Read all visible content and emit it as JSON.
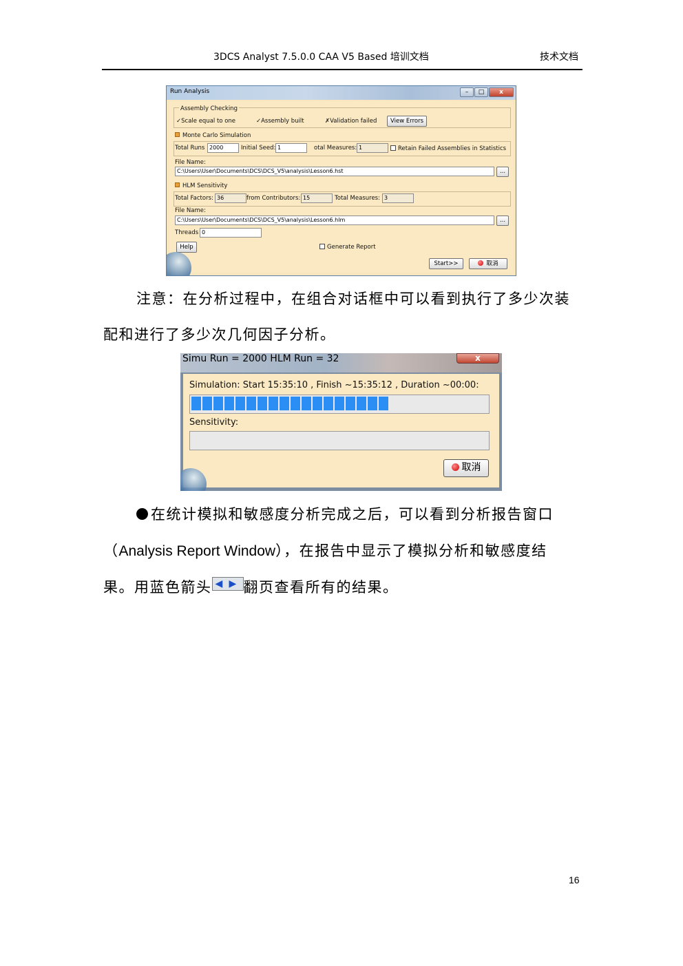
{
  "header": {
    "title": "3DCS Analyst 7.5.0.0 CAA V5 Based 培训文档",
    "doc_type": "技术文档"
  },
  "run_analysis": {
    "title": "Run Analysis",
    "assembly_checking": "Assembly Checking",
    "scale_equal": "✓Scale equal to one",
    "assembly_built": "✓Assembly built",
    "validation_failed": "✗Validation failed",
    "view_errors": "View Errors",
    "monte_carlo": "Monte Carlo Simulation",
    "total_runs_label": "Total Runs",
    "total_runs_value": "2000",
    "initial_seed_label": "Initial Seed:",
    "initial_seed_value": "1",
    "total_measures_label": "otal Measures:",
    "total_measures_value": "1",
    "retain_failed": "Retain Failed Assemblies in Statistics",
    "file_name_label": "File Name:",
    "mc_file": "C:\\Users\\User\\Documents\\DCS\\DCS_V5\\analysis\\Lesson6.hst",
    "browse": "...",
    "hlm_sensitivity": "HLM Sensitivity",
    "total_factors_label": "Total Factors:",
    "total_factors_value": "36",
    "from_contributors_label": "from Contributors:",
    "from_contributors_value": "15",
    "hlm_total_measures_label": "Total Measures:",
    "hlm_total_measures_value": "3",
    "hlm_file": "C:\\Users\\User\\Documents\\DCS\\DCS_V5\\analysis\\Lesson6.hlm",
    "threads_label": "Threads",
    "threads_value": "0",
    "help": "Help",
    "generate_report": "Generate Report",
    "start": "Start>>",
    "cancel": "取消"
  },
  "para1_line1": "注意：在分析过程中，在组合对话框中可以看到执行了多少次装",
  "para1_line2": "配和进行了多少次几何因子分析。",
  "simu": {
    "title": "Simu Run = 2000 HLM Run = 32",
    "close": "x",
    "simulation_text": "Simulation: Start 15:35:10 , Finish ~15:35:12 , Duration ~00:00:",
    "progress": 0.69,
    "sensitivity_label": "Sensitivity:",
    "cancel": "取消"
  },
  "para2_line1": "在统计模拟和敏感度分析完成之后，可以看到分析报告窗口",
  "para2_line2_open": "（",
  "para2_line2_latin": "Analysis Report Window",
  "para2_line2_rest": "），在报告中显示了模拟分析和敏感度结",
  "para2_line3_a": "果。用蓝色箭头",
  "para2_line3_b": "翻页查看所有的结果。",
  "page_number": "16"
}
